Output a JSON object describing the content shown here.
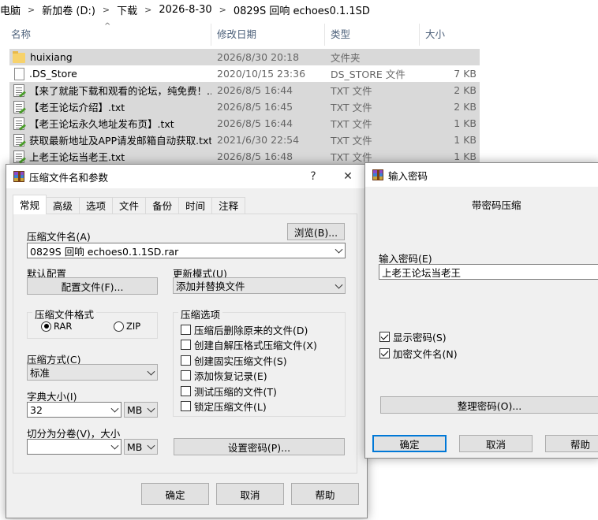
{
  "explorer": {
    "breadcrumb": [
      "电脑",
      "新加卷 (D:)",
      "下载",
      "2026-8-30",
      "0829S 回响 echoes0.1.1SD"
    ],
    "columns": {
      "name": "名称",
      "date": "修改日期",
      "type": "类型",
      "size": "大小"
    },
    "rows": [
      {
        "icon": "folder-icon",
        "name": "huixiang",
        "date": "2026/8/30 20:18",
        "type": "文件夹",
        "size": ""
      },
      {
        "icon": "file-icon",
        "name": ".DS_Store",
        "date": "2020/10/15 23:36",
        "type": "DS_STORE 文件",
        "size": "7 KB"
      },
      {
        "icon": "txt-file-icon",
        "name": "【来了就能下载和观看的论坛，纯免费！...",
        "date": "2026/8/5 16:44",
        "type": "TXT 文件",
        "size": "2 KB"
      },
      {
        "icon": "txt-file-icon",
        "name": "【老王论坛介绍】.txt",
        "date": "2026/8/5 16:45",
        "type": "TXT 文件",
        "size": "2 KB"
      },
      {
        "icon": "txt-file-icon",
        "name": "【老王论坛永久地址发布页】.txt",
        "date": "2026/8/5 16:44",
        "type": "TXT 文件",
        "size": "1 KB"
      },
      {
        "icon": "txt-file-icon",
        "name": "获取最新地址及APP请发邮箱自动获取.txt",
        "date": "2021/6/30 22:54",
        "type": "TXT 文件",
        "size": "1 KB"
      },
      {
        "icon": "txt-file-icon",
        "name": "上老王论坛当老王.txt",
        "date": "2026/8/5 16:48",
        "type": "TXT 文件",
        "size": "1 KB"
      }
    ]
  },
  "archive_dialog": {
    "title": "压缩文件名和参数",
    "help_glyph": "?",
    "close_glyph": "✕",
    "tabs": [
      "常规",
      "高级",
      "选项",
      "文件",
      "备份",
      "时间",
      "注释"
    ],
    "archive_name_label": "压缩文件名(A)",
    "browse_button": "浏览(B)...",
    "archive_name_value": "0829S 回响 echoes0.1.1SD.rar",
    "default_profile_label": "默认配置",
    "profiles_button": "配置文件(F)...",
    "update_mode_label": "更新模式(U)",
    "update_mode_value": "添加并替换文件",
    "format_group_title": "压缩文件格式",
    "format_rar": "RAR",
    "format_zip": "ZIP",
    "options_group_title": "压缩选项",
    "options": [
      {
        "label": "压缩后删除原来的文件(D)",
        "checked": false
      },
      {
        "label": "创建自解压格式压缩文件(X)",
        "checked": false
      },
      {
        "label": "创建固实压缩文件(S)",
        "checked": false
      },
      {
        "label": "添加恢复记录(E)",
        "checked": false
      },
      {
        "label": "测试压缩的文件(T)",
        "checked": false
      },
      {
        "label": "锁定压缩文件(L)",
        "checked": false
      }
    ],
    "method_label": "压缩方式(C)",
    "method_value": "标准",
    "dict_label": "字典大小(I)",
    "dict_value": "32",
    "dict_unit": "MB",
    "split_label": "切分为分卷(V)，大小",
    "split_value": "",
    "split_unit": "MB",
    "set_password_button": "设置密码(P)...",
    "ok_button": "确定",
    "cancel_button": "取消",
    "help_button": "帮助"
  },
  "password_dialog": {
    "title": "输入密码",
    "heading": "带密码压缩",
    "password_label": "输入密码(E)",
    "password_value": "上老王论坛当老王",
    "show_password_label": "显示密码(S)",
    "show_password_checked": true,
    "encrypt_names_label": "加密文件名(N)",
    "encrypt_names_checked": true,
    "organize_button": "整理密码(O)...",
    "ok_button": "确定",
    "cancel_button": "取消",
    "help_button": "帮助"
  },
  "colors": {
    "selection": "#d9d9d9",
    "dialog_bg": "#f0f0f0",
    "accent": "#0078d7",
    "header_text": "#4c607a"
  }
}
